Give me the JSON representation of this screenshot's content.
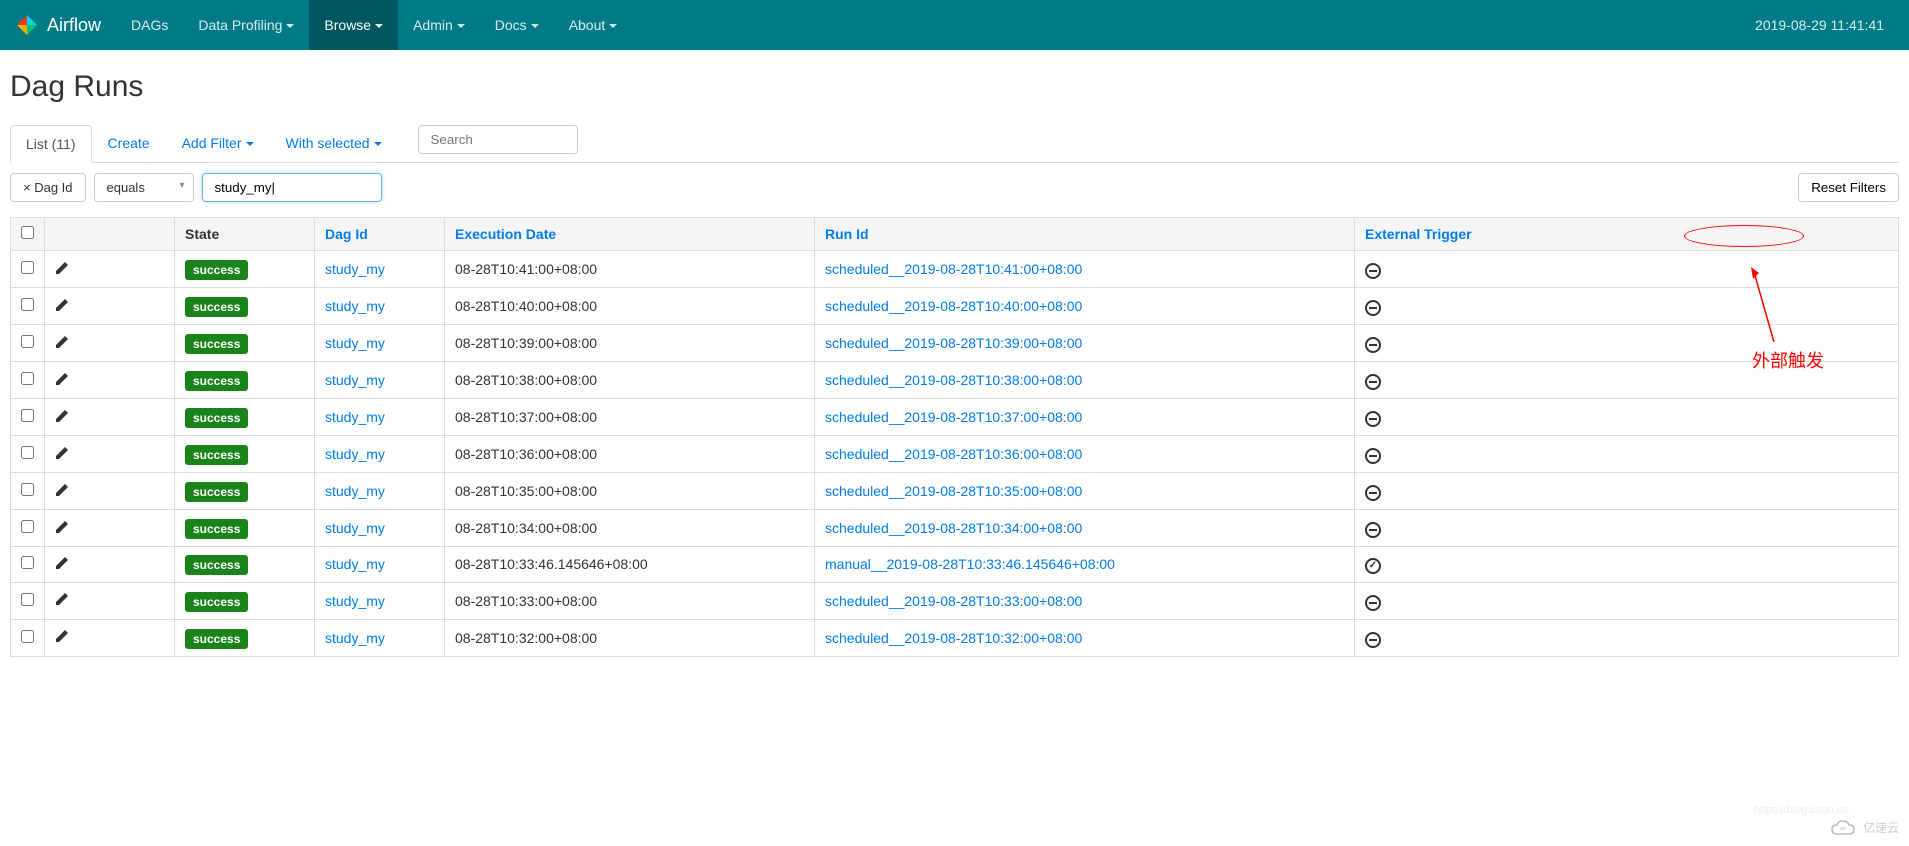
{
  "navbar": {
    "brand": "Airflow",
    "items": [
      {
        "label": "DAGs",
        "dropdown": false
      },
      {
        "label": "Data Profiling",
        "dropdown": true
      },
      {
        "label": "Browse",
        "dropdown": true,
        "active": true
      },
      {
        "label": "Admin",
        "dropdown": true
      },
      {
        "label": "Docs",
        "dropdown": true
      },
      {
        "label": "About",
        "dropdown": true
      }
    ],
    "timestamp": "2019-08-29 11:41:41"
  },
  "page_title": "Dag Runs",
  "toolbar": {
    "list_tab": "List (11)",
    "create": "Create",
    "add_filter": "Add Filter",
    "with_selected": "With selected",
    "search_placeholder": "Search"
  },
  "filter": {
    "tag_label": "× Dag Id",
    "operator": "equals",
    "value": "study_my|",
    "reset_label": "Reset Filters"
  },
  "table": {
    "headers": {
      "state": "State",
      "dag_id": "Dag Id",
      "execution_date": "Execution Date",
      "run_id": "Run Id",
      "external_trigger": "External Trigger"
    },
    "rows": [
      {
        "state": "success",
        "dag_id": "study_my",
        "execution_date": "08-28T10:41:00+08:00",
        "run_id": "scheduled__2019-08-28T10:41:00+08:00",
        "external_trigger": false
      },
      {
        "state": "success",
        "dag_id": "study_my",
        "execution_date": "08-28T10:40:00+08:00",
        "run_id": "scheduled__2019-08-28T10:40:00+08:00",
        "external_trigger": false
      },
      {
        "state": "success",
        "dag_id": "study_my",
        "execution_date": "08-28T10:39:00+08:00",
        "run_id": "scheduled__2019-08-28T10:39:00+08:00",
        "external_trigger": false
      },
      {
        "state": "success",
        "dag_id": "study_my",
        "execution_date": "08-28T10:38:00+08:00",
        "run_id": "scheduled__2019-08-28T10:38:00+08:00",
        "external_trigger": false
      },
      {
        "state": "success",
        "dag_id": "study_my",
        "execution_date": "08-28T10:37:00+08:00",
        "run_id": "scheduled__2019-08-28T10:37:00+08:00",
        "external_trigger": false
      },
      {
        "state": "success",
        "dag_id": "study_my",
        "execution_date": "08-28T10:36:00+08:00",
        "run_id": "scheduled__2019-08-28T10:36:00+08:00",
        "external_trigger": false
      },
      {
        "state": "success",
        "dag_id": "study_my",
        "execution_date": "08-28T10:35:00+08:00",
        "run_id": "scheduled__2019-08-28T10:35:00+08:00",
        "external_trigger": false
      },
      {
        "state": "success",
        "dag_id": "study_my",
        "execution_date": "08-28T10:34:00+08:00",
        "run_id": "scheduled__2019-08-28T10:34:00+08:00",
        "external_trigger": false
      },
      {
        "state": "success",
        "dag_id": "study_my",
        "execution_date": "08-28T10:33:46.145646+08:00",
        "run_id": "manual__2019-08-28T10:33:46.145646+08:00",
        "external_trigger": true
      },
      {
        "state": "success",
        "dag_id": "study_my",
        "execution_date": "08-28T10:33:00+08:00",
        "run_id": "scheduled__2019-08-28T10:33:00+08:00",
        "external_trigger": false
      },
      {
        "state": "success",
        "dag_id": "study_my",
        "execution_date": "08-28T10:32:00+08:00",
        "run_id": "scheduled__2019-08-28T10:32:00+08:00",
        "external_trigger": false
      }
    ]
  },
  "annotation": {
    "text": "外部触发"
  },
  "watermark": {
    "text": "亿速云",
    "url": "https://blog.csdn.ne"
  }
}
